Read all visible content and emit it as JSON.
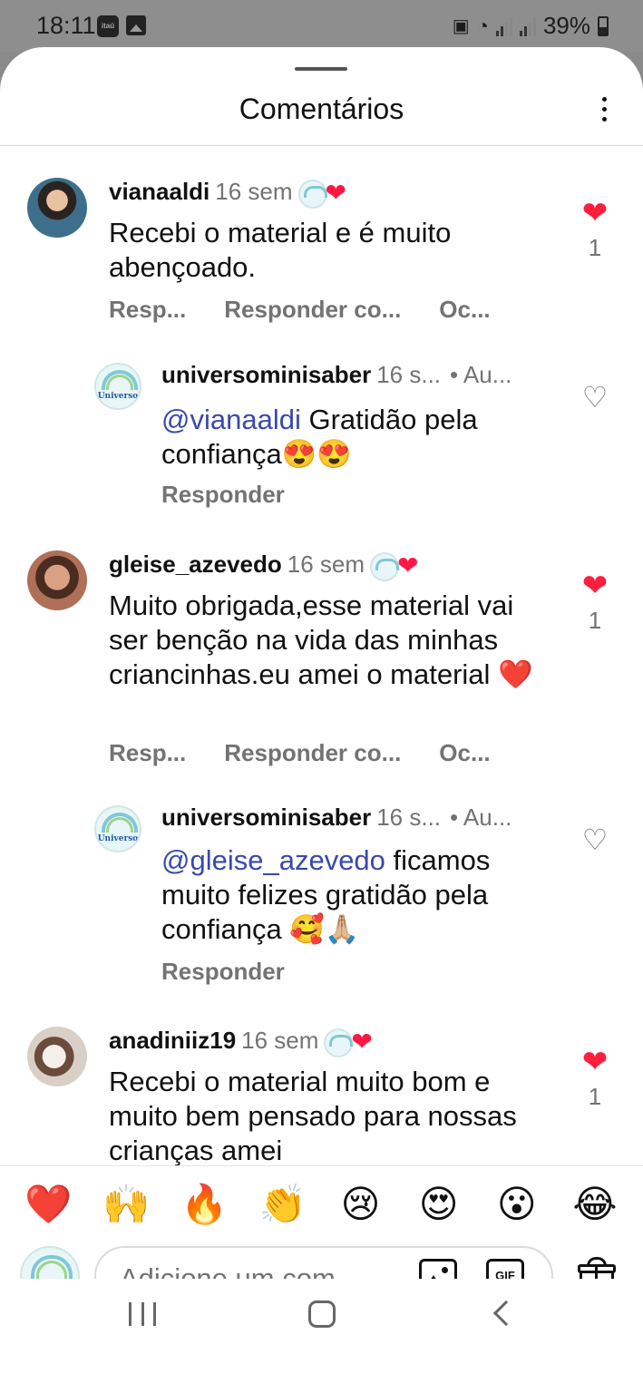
{
  "status_bar": {
    "time": "18:11",
    "itau_label": "itaú",
    "battery": "39%"
  },
  "sheet": {
    "title": "Comentários"
  },
  "comments": [
    {
      "username": "vianaaldi",
      "time": "16 sem",
      "text": "Recebi o material e é muito abençoado.",
      "actions": [
        "Resp...",
        "Responder co...",
        "Oc..."
      ],
      "likes": "1",
      "liked": true
    },
    {
      "username": "universominisaber",
      "time": "16 s...",
      "author_tag": "• Au...",
      "mention": "@vianaaldi",
      "text": " Gratidão pela confiança😍😍",
      "actions": [
        "Responder"
      ],
      "liked": false
    },
    {
      "username": "gleise_azevedo",
      "time": "16 sem",
      "text": "Muito obrigada,esse material vai ser benção na vida das minhas criancinhas.eu amei o material ❤️",
      "actions": [
        "Resp...",
        "Responder co...",
        "Oc..."
      ],
      "likes": "1",
      "liked": true
    },
    {
      "username": "universominisaber",
      "time": "16 s...",
      "author_tag": "• Au...",
      "mention": "@gleise_azevedo",
      "text": " ficamos muito felizes gratidão pela confiança 🥰🙏🏼",
      "actions": [
        "Responder"
      ],
      "liked": false
    },
    {
      "username": "anadiniiz19",
      "time": "16 sem",
      "text": "Recebi o material muito bom e muito bem pensado para nossas crianças amei",
      "likes": "1",
      "liked": true
    }
  ],
  "brand_logo_text": "Universo",
  "reactions": [
    "❤️",
    "🙌",
    "🔥",
    "👏",
    "😢",
    "😍",
    "😮",
    "😂"
  ],
  "composer": {
    "placeholder": "Adicione um com...",
    "gif_label": "GIF"
  },
  "icons": [
    "more-vertical-icon",
    "heart-icon",
    "image-icon",
    "gif-icon",
    "gift-icon",
    "nav-recents-icon",
    "nav-home-icon",
    "nav-back-icon"
  ],
  "colors": {
    "like_red": "#ff1e3c",
    "mention_blue": "#3949ab",
    "muted_gray": "#737373"
  }
}
